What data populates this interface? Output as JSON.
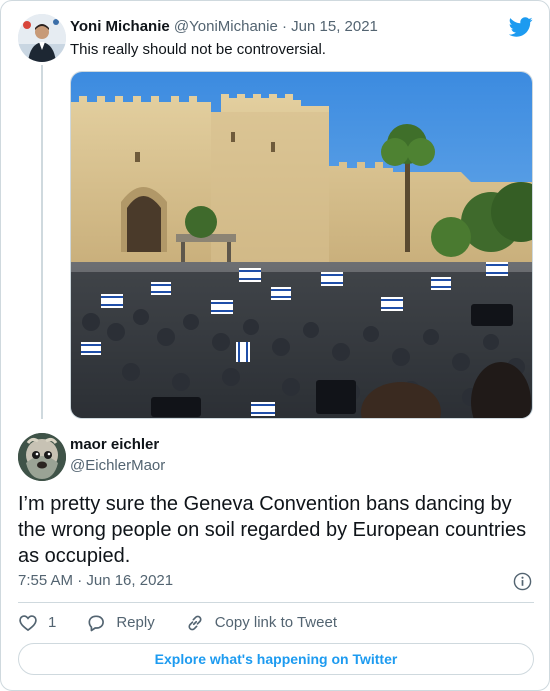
{
  "colors": {
    "brand": "#1d9bf0",
    "text_primary": "#0f1419",
    "text_secondary": "#536471",
    "border": "#cfd9de"
  },
  "parent_tweet": {
    "author_name": "Yoni Michanie",
    "author_handle": "@YoniMichanie",
    "separator": " · ",
    "date": "Jun 15, 2021",
    "text": "This really should not be controversial.",
    "avatar_icon": "person-avatar",
    "media_icon": "photo-crowd-with-flags-at-city-gate"
  },
  "main_tweet": {
    "author_name": "maor eichler",
    "author_handle": "@EichlerMaor",
    "avatar_icon": "dog-avatar",
    "text": "I’m pretty sure the Geneva Convention bans dancing by the wrong people on soil regarded by European countries as occupied.",
    "timestamp": "7:55 AM · Jun 16, 2021"
  },
  "actions": {
    "like_count": "1",
    "reply_label": "Reply",
    "copy_link_label": "Copy link to Tweet"
  },
  "footer": {
    "explore_label": "Explore what's happening on Twitter"
  },
  "icons": {
    "brand_logo": "twitter-bird-icon",
    "info": "info-icon",
    "like": "heart-icon",
    "reply": "reply-bubble-icon",
    "copy_link": "link-icon"
  }
}
